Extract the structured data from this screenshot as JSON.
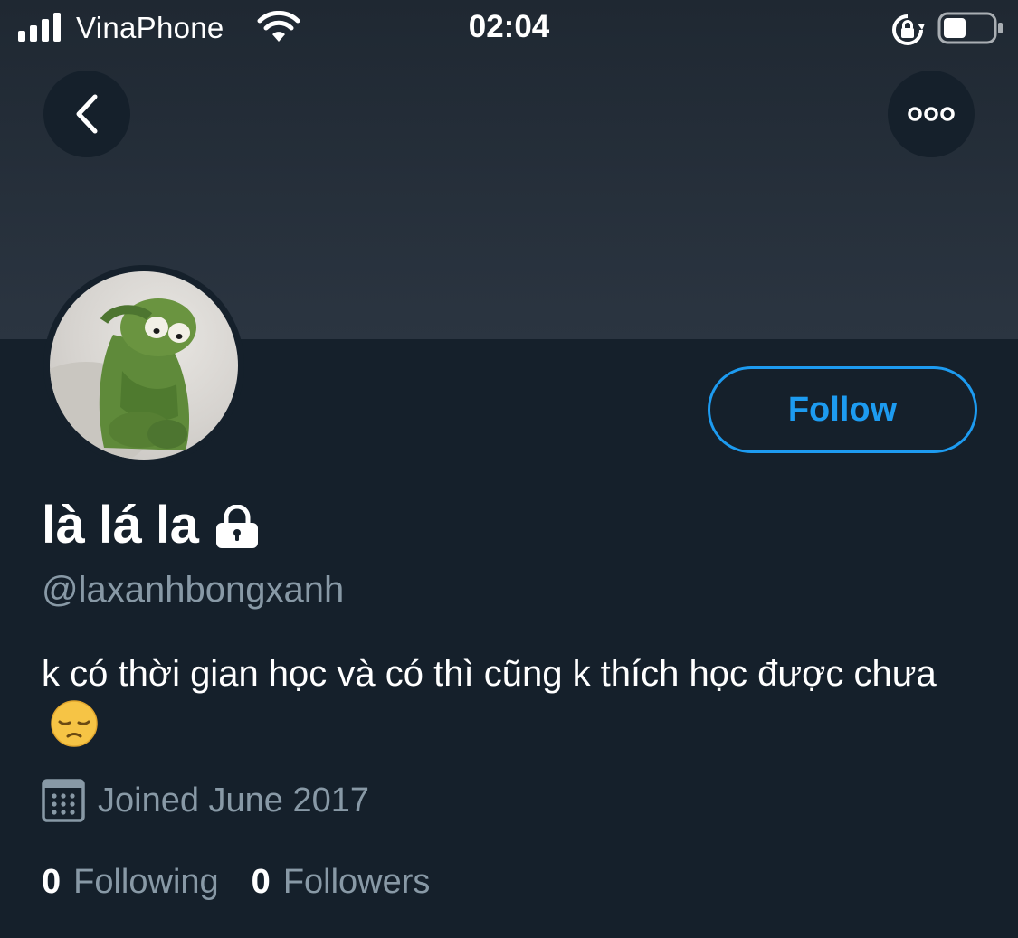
{
  "status_bar": {
    "carrier": "VinaPhone",
    "time": "02:04",
    "icons": [
      "signal-icon",
      "wifi-icon",
      "rotation-lock-icon",
      "battery-icon"
    ]
  },
  "header": {
    "back_icon": "chevron-left-icon",
    "more_icon": "more-horizontal-icon"
  },
  "profile": {
    "display_name": "là lá la",
    "protected_icon": "lock-icon",
    "handle": "@laxanhbongxanh",
    "bio": "k có thời gian học và có thì cũng k thích học được chưa",
    "bio_emoji_icon": "pensive-face-icon",
    "joined": "Joined June 2017",
    "joined_icon": "calendar-icon",
    "following_count": "0",
    "following_label": "Following",
    "followers_count": "0",
    "followers_label": "Followers"
  },
  "actions": {
    "follow_label": "Follow"
  },
  "colors": {
    "background": "#15202b",
    "accent": "#1d9bf0",
    "secondary_text": "#8899a6"
  }
}
